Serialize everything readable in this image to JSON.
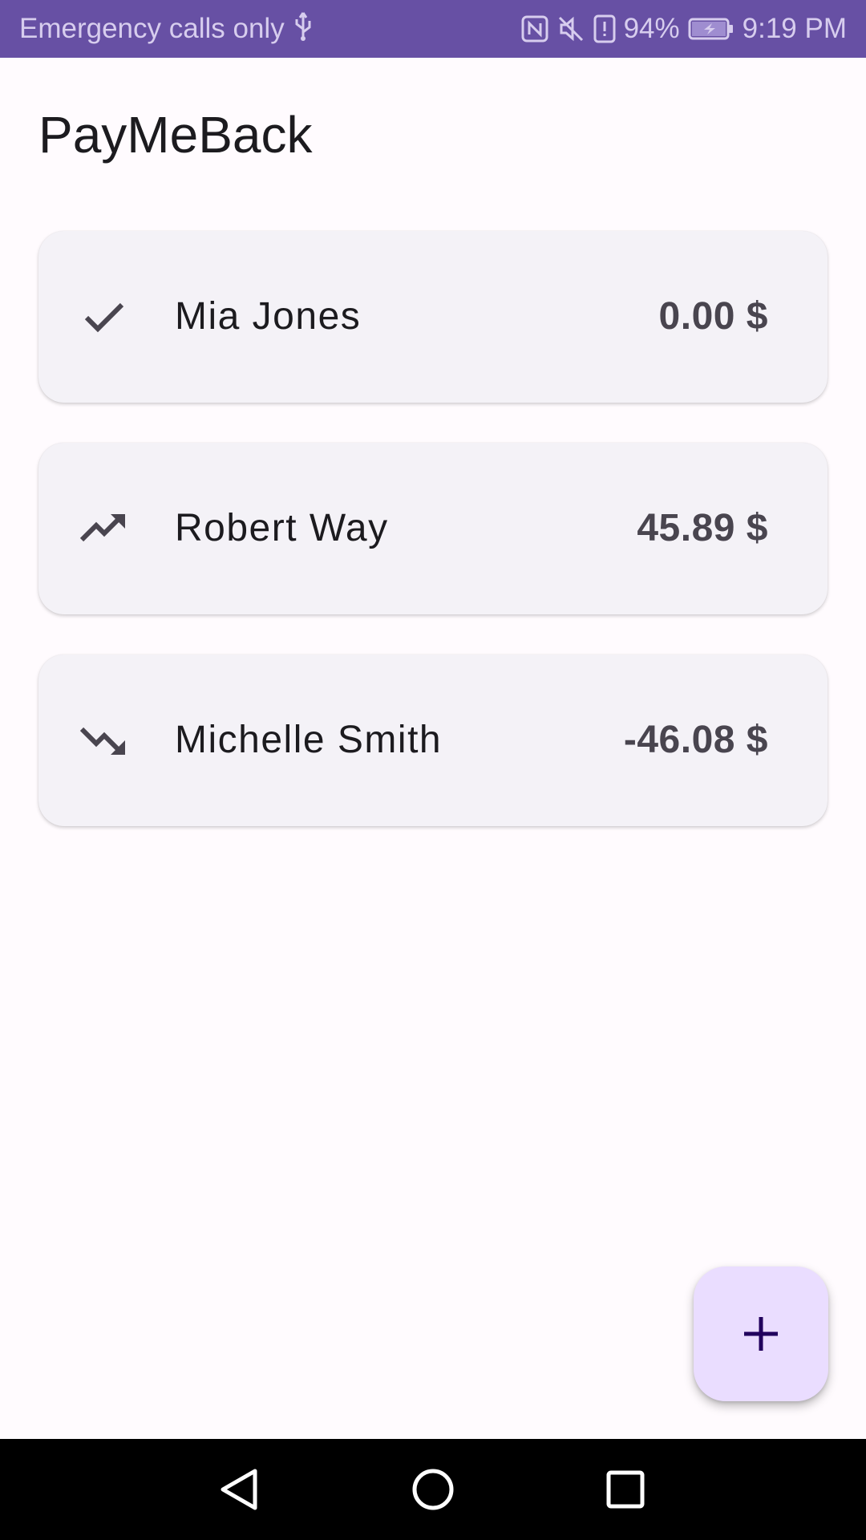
{
  "status_bar": {
    "carrier_text": "Emergency calls only",
    "battery_percent": "94%",
    "time": "9:19 PM",
    "icons": [
      "usb-icon",
      "nfc-icon",
      "mute-icon",
      "alert-icon",
      "battery-charging-icon"
    ]
  },
  "app": {
    "title": "PayMeBack"
  },
  "debts": [
    {
      "name": "Mia Jones",
      "amount": "0.00 $",
      "icon": "check-icon"
    },
    {
      "name": "Robert Way",
      "amount": "45.89 $",
      "icon": "trending-up-icon"
    },
    {
      "name": "Michelle Smith",
      "amount": "-46.08 $",
      "icon": "trending-down-icon"
    }
  ],
  "fab": {
    "icon": "plus-icon"
  },
  "navigation": {
    "icons": [
      "back-icon",
      "home-icon",
      "recents-icon"
    ]
  },
  "colors": {
    "status_bar": "#6750a4",
    "background": "#fffbfe",
    "card": "#f4f2f7",
    "fab": "#eaddff",
    "icon": "#49454f"
  }
}
